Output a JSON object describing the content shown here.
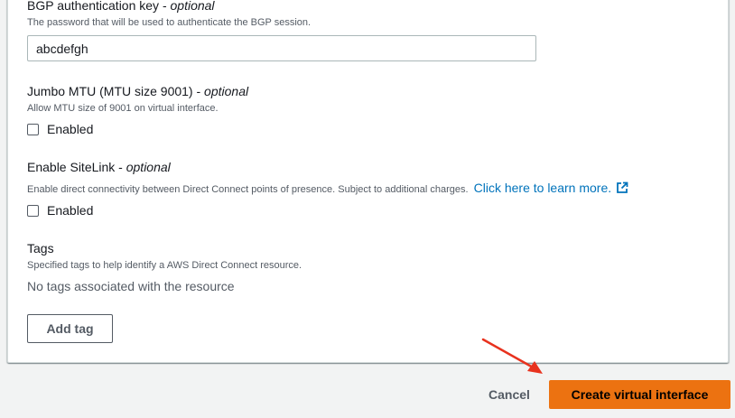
{
  "bgp_auth": {
    "label": "BGP authentication key - ",
    "optional": "optional",
    "description": "The password that will be used to authenticate the BGP session.",
    "value": "abcdefgh"
  },
  "jumbo_mtu": {
    "label": "Jumbo MTU (MTU size 9001) - ",
    "optional": "optional",
    "description": "Allow MTU size of 9001 on virtual interface.",
    "checkbox_label": "Enabled",
    "checked": false
  },
  "sitelink": {
    "label": "Enable SiteLink - ",
    "optional": "optional",
    "description": "Enable direct connectivity between Direct Connect points of presence. Subject to additional charges.",
    "link_text": "Click here to learn more.",
    "checkbox_label": "Enabled",
    "checked": false
  },
  "tags": {
    "label": "Tags",
    "description": "Specified tags to help identify a AWS Direct Connect resource.",
    "empty_text": "No tags associated with the resource",
    "add_button": "Add tag"
  },
  "footer": {
    "cancel_label": "Cancel",
    "create_label": "Create virtual interface"
  },
  "colors": {
    "primary_button": "#ec7211",
    "link": "#0073bb",
    "annotation_arrow": "#e8321e"
  }
}
